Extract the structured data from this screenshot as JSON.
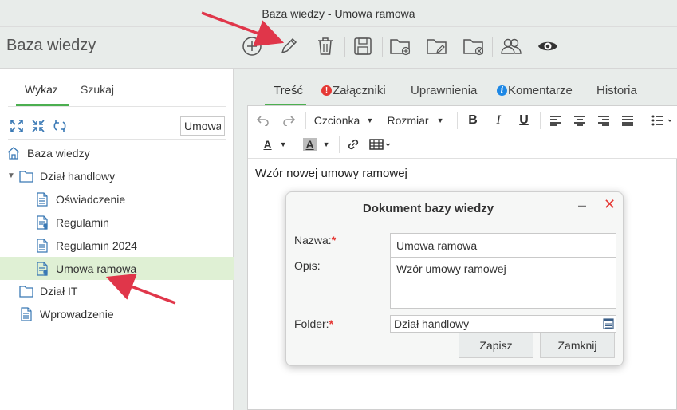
{
  "window": {
    "title": "Baza wiedzy - Umowa ramowa"
  },
  "header": {
    "app_title": "Baza wiedzy"
  },
  "toolbar": {
    "icons": [
      "add-icon",
      "edit-pencil-icon",
      "trash-icon",
      "save-icon",
      "folder-add-icon",
      "folder-edit-icon",
      "folder-delete-icon",
      "users-icon",
      "eye-icon"
    ]
  },
  "left": {
    "tabs": [
      {
        "label": "Wykaz"
      },
      {
        "label": "Szukaj"
      }
    ],
    "search_value": "Umowa",
    "tree": [
      {
        "label": "Baza wiedzy",
        "icon": "home-icon"
      },
      {
        "label": "Dział handlowy",
        "icon": "folder-icon"
      },
      {
        "label": "Oświadczenie",
        "icon": "document-icon"
      },
      {
        "label": "Regulamin",
        "icon": "document-pin-icon"
      },
      {
        "label": "Regulamin 2024",
        "icon": "document-icon"
      },
      {
        "label": "Umowa ramowa",
        "icon": "document-pin-icon"
      },
      {
        "label": "Dział IT",
        "icon": "folder-icon"
      },
      {
        "label": "Wprowadzenie",
        "icon": "document-icon"
      }
    ]
  },
  "right": {
    "tabs": [
      {
        "label": "Treść"
      },
      {
        "label": "Załączniki",
        "badge": "!"
      },
      {
        "label": "Uprawnienia"
      },
      {
        "label": "Komentarze",
        "badge": "i"
      },
      {
        "label": "Historia"
      }
    ],
    "editor": {
      "font_label": "Czcionka",
      "size_label": "Rozmiar",
      "bold": "B",
      "italic": "I",
      "underline": "U",
      "text_color_glyph": "A",
      "bg_color_glyph": "A",
      "content": "Wzór nowej umowy ramowej"
    }
  },
  "dialog": {
    "title": "Dokument bazy wiedzy",
    "minimize": "–",
    "close": "✕",
    "name_label": "Nazwa:",
    "name_value": "Umowa ramowa",
    "desc_label": "Opis:",
    "desc_value": "Wzór umowy ramowej",
    "folder_label": "Folder:",
    "folder_value": "Dział handlowy",
    "required_mark": "*",
    "save_label": "Zapisz",
    "close_label": "Zamknij"
  },
  "colors": {
    "accent": "#4caf50",
    "selected_row": "#dff0d4",
    "required": "#e53935",
    "annotation_arrow": "#e0364a"
  }
}
